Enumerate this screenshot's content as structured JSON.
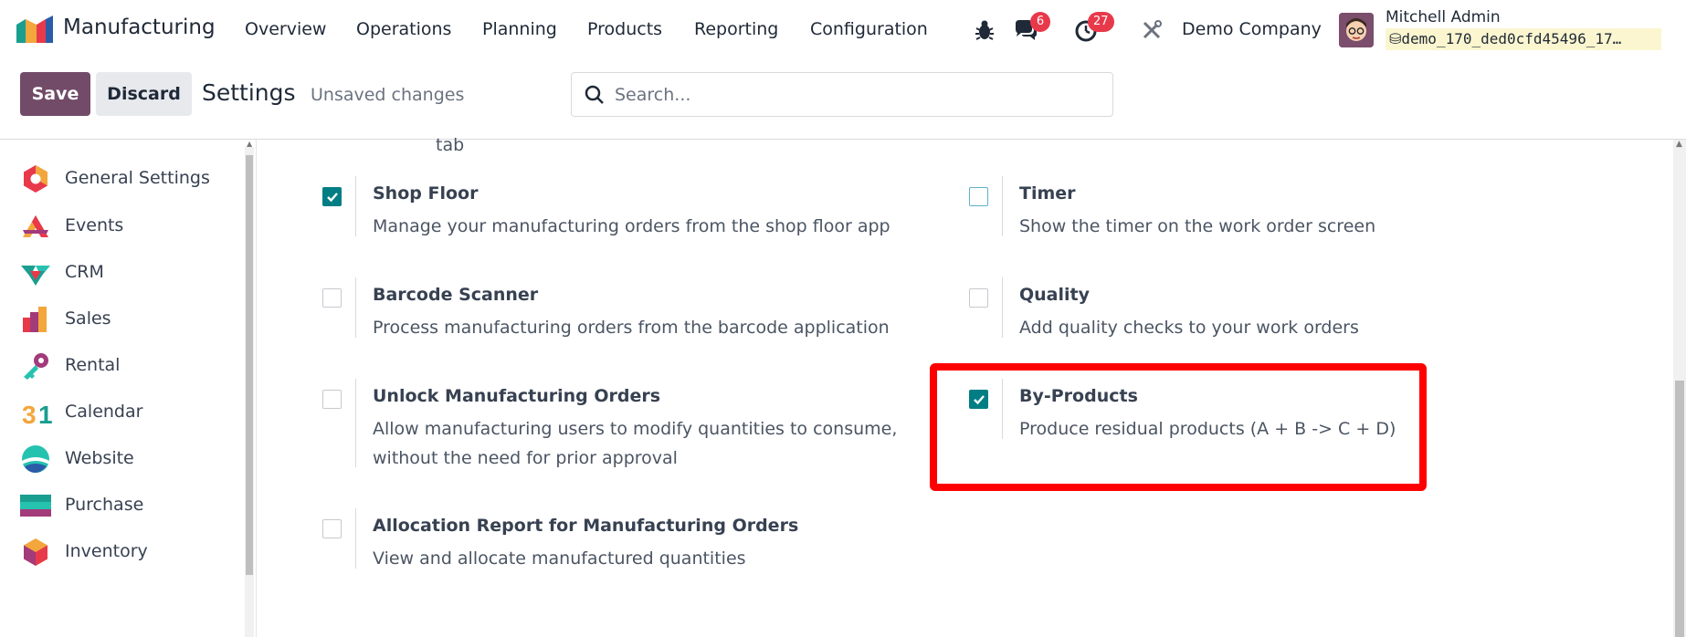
{
  "navbar": {
    "app_name": "Manufacturing",
    "menu": [
      "Overview",
      "Operations",
      "Planning",
      "Products",
      "Reporting",
      "Configuration"
    ],
    "messages_badge": "6",
    "activities_badge": "27",
    "company": "Demo Company",
    "user_name": "Mitchell Admin",
    "database": "demo_170_ded0cfd45496_17…"
  },
  "controlbar": {
    "save_label": "Save",
    "discard_label": "Discard",
    "title": "Settings",
    "status": "Unsaved changes",
    "search_placeholder": "Search..."
  },
  "sidebar": {
    "items": [
      {
        "label": "General Settings",
        "icon": "general-settings-icon"
      },
      {
        "label": "Events",
        "icon": "events-icon"
      },
      {
        "label": "CRM",
        "icon": "crm-icon"
      },
      {
        "label": "Sales",
        "icon": "sales-icon"
      },
      {
        "label": "Rental",
        "icon": "rental-icon"
      },
      {
        "label": "Calendar",
        "icon": "calendar-icon"
      },
      {
        "label": "Website",
        "icon": "website-icon"
      },
      {
        "label": "Purchase",
        "icon": "purchase-icon"
      },
      {
        "label": "Inventory",
        "icon": "inventory-icon"
      }
    ]
  },
  "content": {
    "partial_text": "tab",
    "settings": [
      {
        "title": "Shop Floor",
        "desc": [
          "Manage your manufacturing orders from the shop floor app"
        ],
        "checked": true
      },
      {
        "title": "Timer",
        "desc": [
          "Show the timer on the work order screen"
        ],
        "checked": false
      },
      {
        "title": "Barcode Scanner",
        "desc": [
          "Process manufacturing orders from the barcode application"
        ],
        "checked": false
      },
      {
        "title": "Quality",
        "desc": [
          "Add quality checks to your work orders"
        ],
        "checked": false
      },
      {
        "title": "Unlock Manufacturing Orders",
        "desc": [
          "Allow manufacturing users to modify quantities to consume,",
          "without the need for prior approval"
        ],
        "checked": false
      },
      {
        "title": "By-Products",
        "desc": [
          "Produce residual products (A + B -> C + D)"
        ],
        "checked": true
      },
      {
        "title": "Allocation Report for Manufacturing Orders",
        "desc": [
          "View and allocate manufactured quantities"
        ],
        "checked": false
      }
    ]
  },
  "colors": {
    "primary": "#714b67",
    "checkbox_checked": "#017e84",
    "badge": "#e8394b",
    "highlight": "#ff0000"
  }
}
